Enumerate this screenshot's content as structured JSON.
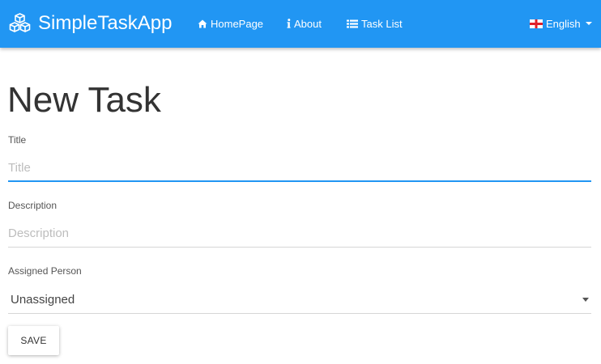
{
  "navbar": {
    "brand": "SimpleTaskApp",
    "items": [
      {
        "label": "HomePage",
        "icon": "home-icon"
      },
      {
        "label": "About",
        "icon": "info-icon"
      },
      {
        "label": "Task List",
        "icon": "list-icon"
      }
    ],
    "language": {
      "label": "English",
      "icon": "flag-england-icon"
    }
  },
  "page": {
    "title": "New Task"
  },
  "form": {
    "title_label": "Title",
    "title_placeholder": "Title",
    "title_value": "",
    "description_label": "Description",
    "description_placeholder": "Description",
    "description_value": "",
    "assigned_label": "Assigned Person",
    "assigned_value": "Unassigned",
    "save_label": "SAVE"
  },
  "colors": {
    "navbar_bg": "#2196f3",
    "focus_underline": "#2196f3"
  }
}
